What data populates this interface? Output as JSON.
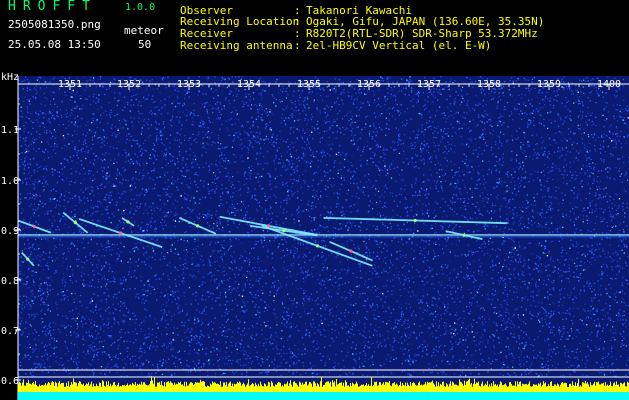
{
  "header": {
    "app_title": "HROFFT",
    "app_version": "1.0.0",
    "filename": "2505081350.png",
    "timestamp": "25.05.08 13:50",
    "meteor_label": "meteor",
    "meteor_count": "50"
  },
  "info": [
    {
      "label": "Observer",
      "value": "Takanori Kawachi"
    },
    {
      "label": "Receiving Location",
      "value": "Ogaki, Gifu, JAPAN (136.60E, 35.35N)"
    },
    {
      "label": "Receiver",
      "value": "R820T2(RTL-SDR) SDR-Sharp 53.372MHz"
    },
    {
      "label": "Receiving antenna",
      "value": "2el-HB9CV Vertical (el. E-W)"
    }
  ],
  "info_separator": ":",
  "colors": {
    "text_white": "#ffffff",
    "text_green": "#00ff66",
    "text_yellow": "#ffff00",
    "background_blue": "#0a1a70",
    "noise_floor": "#00ffff",
    "noise_peaks": "#ffff00"
  },
  "chart_data": {
    "type": "heatmap",
    "xlabel": "",
    "ylabel": "kHz",
    "x_ticks": [
      "1351",
      "1352",
      "1353",
      "1354",
      "1355",
      "1356",
      "1357",
      "1358",
      "1359",
      "1400"
    ],
    "y_ticks": [
      "1.1",
      "1.0",
      "0.9",
      "0.8",
      "0.7",
      "0.6"
    ],
    "ylim": [
      0.6,
      1.15
    ],
    "carrier_frequency_khz": 0.878,
    "meteor_traces": [
      {
        "t_start": 13.5,
        "t_end": 13.527,
        "f_start": 0.905,
        "f_end": 0.882
      },
      {
        "t_start": 13.503,
        "t_end": 13.513,
        "f_start": 0.845,
        "f_end": 0.82
      },
      {
        "t_start": 13.537,
        "t_end": 13.557,
        "f_start": 0.92,
        "f_end": 0.882
      },
      {
        "t_start": 13.55,
        "t_end": 13.618,
        "f_start": 0.908,
        "f_end": 0.855
      },
      {
        "t_start": 13.585,
        "t_end": 13.595,
        "f_start": 0.91,
        "f_end": 0.895
      },
      {
        "t_start": 13.632,
        "t_end": 13.662,
        "f_start": 0.91,
        "f_end": 0.88
      },
      {
        "t_start": 13.665,
        "t_end": 13.745,
        "f_start": 0.912,
        "f_end": 0.878
      },
      {
        "t_start": 13.69,
        "t_end": 13.745,
        "f_start": 0.895,
        "f_end": 0.877
      },
      {
        "t_start": 13.7,
        "t_end": 13.79,
        "f_start": 0.895,
        "f_end": 0.82
      },
      {
        "t_start": 13.755,
        "t_end": 13.79,
        "f_start": 0.865,
        "f_end": 0.83
      },
      {
        "t_start": 13.75,
        "t_end": 13.9,
        "f_start": 0.91,
        "f_end": 0.9
      },
      {
        "t_start": 13.85,
        "t_end": 13.88,
        "f_start": 0.885,
        "f_end": 0.87
      }
    ]
  }
}
